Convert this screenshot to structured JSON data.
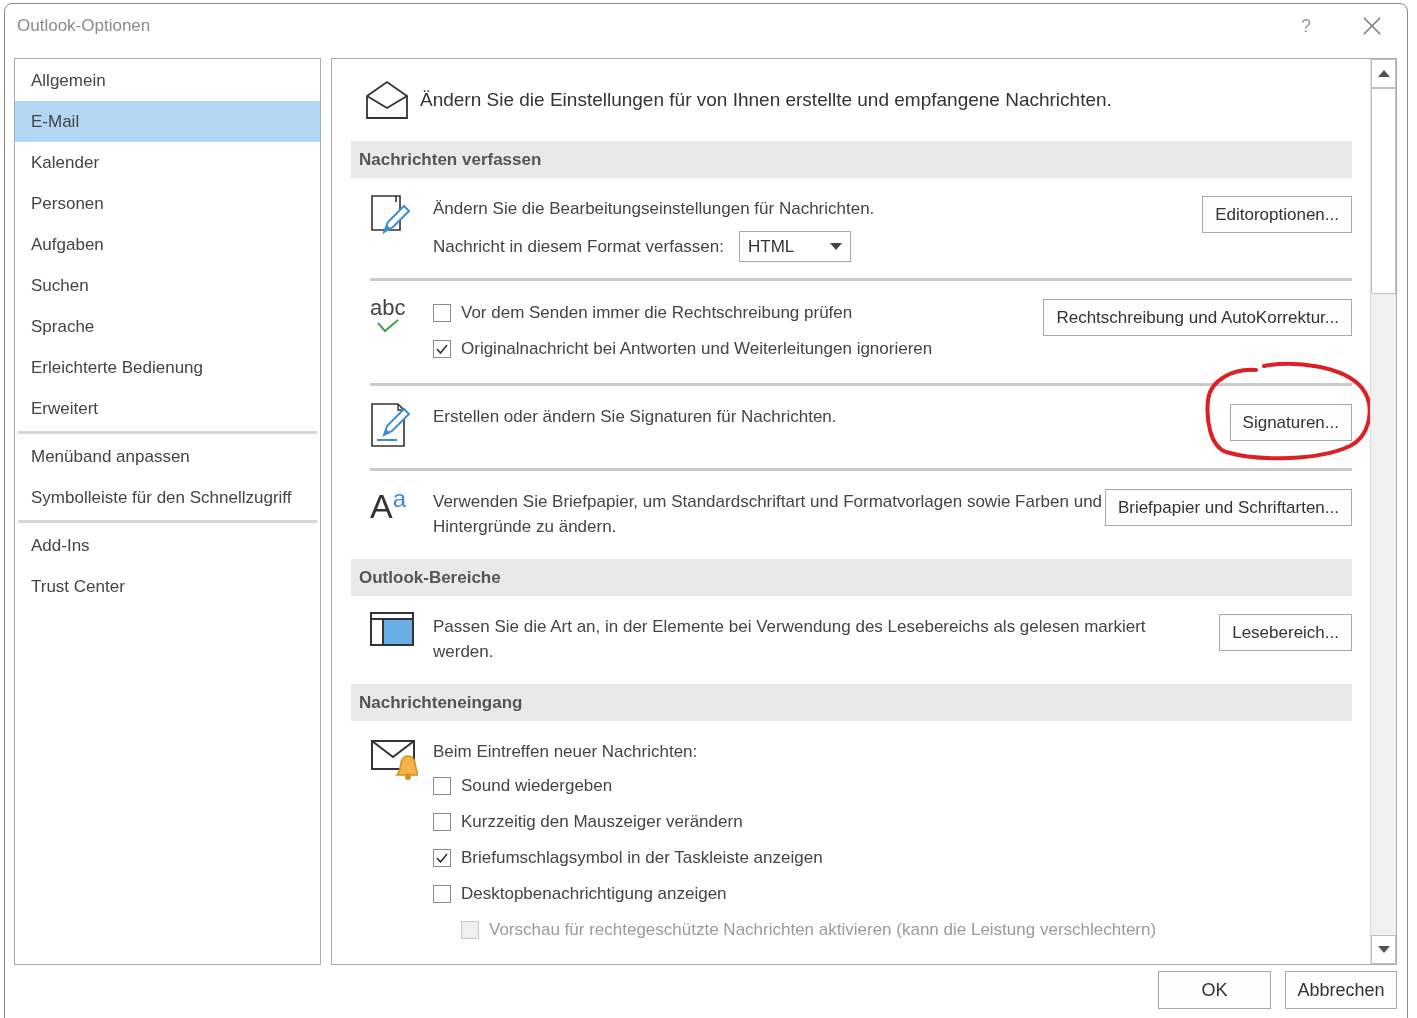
{
  "window": {
    "title": "Outlook-Optionen",
    "help": "?"
  },
  "sidebar": {
    "groups": [
      [
        {
          "label": "Allgemein",
          "selected": false
        },
        {
          "label": "E-Mail",
          "selected": true
        },
        {
          "label": "Kalender",
          "selected": false
        },
        {
          "label": "Personen",
          "selected": false
        },
        {
          "label": "Aufgaben",
          "selected": false
        },
        {
          "label": "Suchen",
          "selected": false
        },
        {
          "label": "Sprache",
          "selected": false
        },
        {
          "label": "Erleichterte Bedienung",
          "selected": false
        },
        {
          "label": "Erweitert",
          "selected": false
        }
      ],
      [
        {
          "label": "Menüband anpassen",
          "selected": false
        },
        {
          "label": "Symbolleiste für den Schnellzugriff",
          "selected": false
        }
      ],
      [
        {
          "label": "Add-Ins",
          "selected": false
        },
        {
          "label": "Trust Center",
          "selected": false
        }
      ]
    ]
  },
  "header": {
    "text": "Ändern Sie die Einstellungen für von Ihnen erstellte und empfangene Nachrichten."
  },
  "sections": [
    {
      "title": "Nachrichten verfassen",
      "rows": [
        {
          "lines": [
            {
              "kind": "text",
              "text": "Ändern Sie die Bearbeitungseinstellungen für Nachrichten."
            },
            {
              "kind": "select",
              "label": "Nachricht in diesem Format verfassen:",
              "value": "HTML"
            }
          ],
          "button": {
            "label": "Editoroptionen...",
            "circled": false
          }
        },
        {
          "icon_label": "abc",
          "lines": [
            {
              "kind": "checkbox",
              "label": "Vor dem Senden immer die Rechtschreibung prüfen",
              "checked": false,
              "disabled": false
            },
            {
              "kind": "checkbox",
              "label": "Originalnachricht bei Antworten und Weiterleitungen ignorieren",
              "checked": true,
              "disabled": false
            }
          ],
          "button": {
            "label": "Rechtschreibung und AutoKorrektur...",
            "circled": false
          }
        },
        {
          "lines": [
            {
              "kind": "text",
              "text": "Erstellen oder ändern Sie Signaturen für Nachrichten."
            }
          ],
          "button": {
            "label": "Signaturen...",
            "circled": true
          }
        },
        {
          "icon_label": "A",
          "icon_label_raised": "a",
          "lines": [
            {
              "kind": "text",
              "text": "Verwenden Sie Briefpapier, um Standardschriftart und Formatvorlagen sowie Farben und Hintergründe zu ändern."
            }
          ],
          "button": {
            "label": "Briefpapier und Schriftarten...",
            "circled": false
          }
        }
      ]
    },
    {
      "title": "Outlook-Bereiche",
      "rows": [
        {
          "lines": [
            {
              "kind": "text",
              "text": "Passen Sie die Art an, in der Elemente bei Verwendung des Lesebereichs als gelesen markiert werden."
            }
          ],
          "button": {
            "label": "Lesebereich...",
            "circled": false
          }
        }
      ]
    },
    {
      "title": "Nachrichteneingang",
      "rows": [
        {
          "lines": [
            {
              "kind": "text",
              "text": "Beim Eintreffen neuer Nachrichten:"
            },
            {
              "kind": "checkbox",
              "label": "Sound wiedergeben",
              "checked": false,
              "disabled": false
            },
            {
              "kind": "checkbox",
              "label": "Kurzzeitig den Mauszeiger verändern",
              "checked": false,
              "disabled": false
            },
            {
              "kind": "checkbox",
              "label": "Briefumschlagsymbol in der Taskleiste anzeigen",
              "checked": true,
              "disabled": false
            },
            {
              "kind": "checkbox",
              "label": "Desktopbenachrichtigung anzeigen",
              "checked": false,
              "disabled": false,
              "children": [
                {
                  "kind": "checkbox",
                  "label": "Vorschau für rechtegeschützte Nachrichten aktivieren (kann die Leistung verschlechtern)",
                  "checked": false,
                  "disabled": true
                }
              ]
            }
          ]
        }
      ]
    }
  ],
  "buttons": [
    "OK",
    "Abbrechen"
  ]
}
